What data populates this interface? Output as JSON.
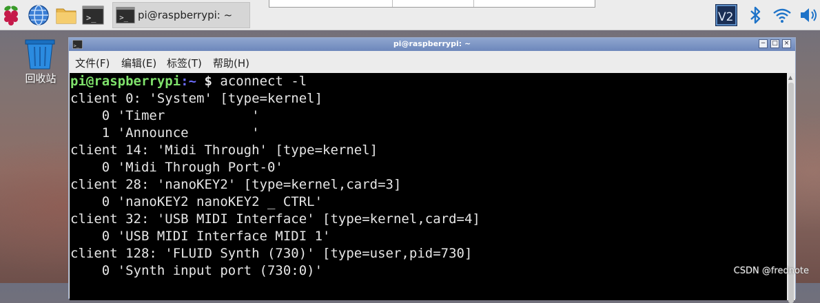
{
  "taskbar": {
    "window_task_label": "pi@raspberrypi: ~"
  },
  "desktop": {
    "trash_label": "回收站"
  },
  "window": {
    "title": "pi@raspberrypi: ~",
    "menu": [
      "文件(F)",
      "编辑(E)",
      "标签(T)",
      "帮助(H)"
    ]
  },
  "terminal": {
    "prompt_user": "pi@raspberrypi",
    "prompt_path": ":~",
    "prompt_symbol": "$",
    "command": " aconnect -l",
    "output": [
      "client 0: 'System' [type=kernel]",
      "    0 'Timer           '",
      "    1 'Announce        '",
      "client 14: 'Midi Through' [type=kernel]",
      "    0 'Midi Through Port-0'",
      "client 28: 'nanoKEY2' [type=kernel,card=3]",
      "    0 'nanoKEY2 nanoKEY2 _ CTRL'",
      "client 32: 'USB MIDI Interface' [type=kernel,card=4]",
      "    0 'USB MIDI Interface MIDI 1'",
      "client 128: 'FLUID Synth (730)' [type=user,pid=730]",
      "    0 'Synth input port (730:0)'"
    ]
  },
  "watermark": "CSDN @frednote",
  "icons": [
    "raspberry-menu-icon",
    "web-browser-icon",
    "file-manager-icon",
    "terminal-icon",
    "vnc-icon",
    "bluetooth-icon",
    "wifi-icon",
    "volume-icon",
    "trash-icon"
  ],
  "colors": {
    "prompt_user": "#7fe16b",
    "prompt_path": "#6d6dff",
    "console_bg": "#000000",
    "titlebar": "#7890c2"
  }
}
